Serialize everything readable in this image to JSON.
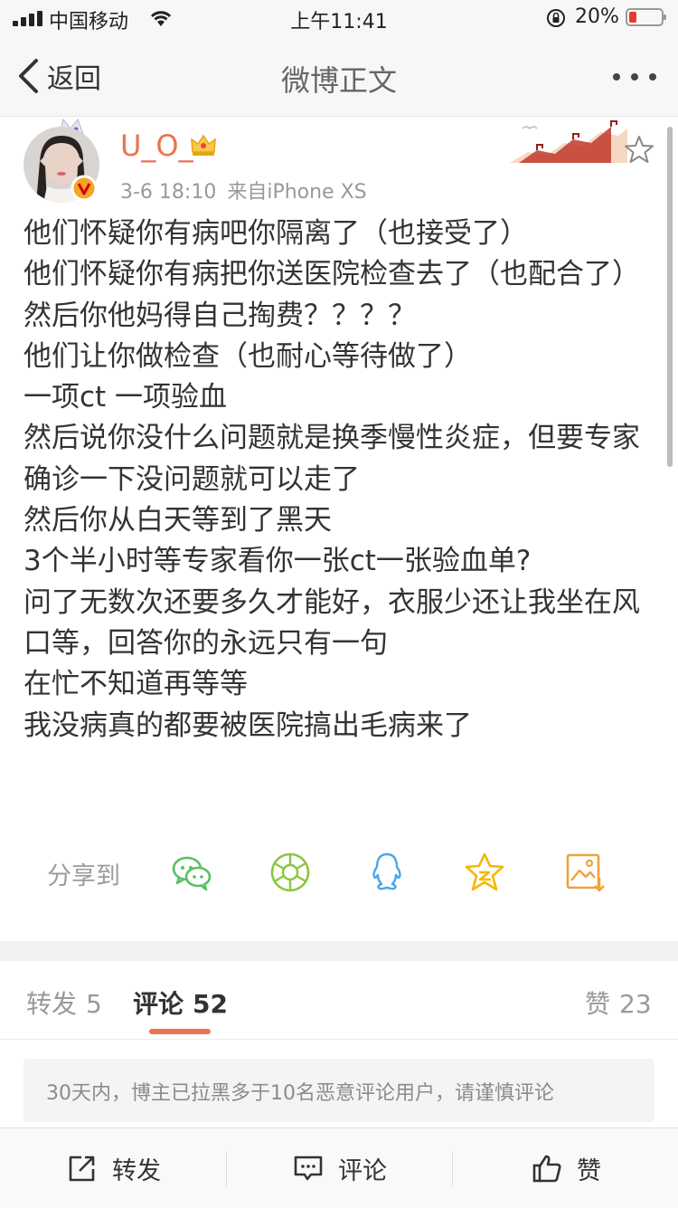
{
  "status_bar": {
    "carrier": "中国移动",
    "time": "上午11:41",
    "battery": "20%"
  },
  "nav": {
    "back_label": "返回",
    "title": "微博正文"
  },
  "post": {
    "username": "U_O_",
    "timestamp": "3-6 18:10",
    "source": "来自iPhone XS",
    "lines": [
      "他们怀疑你有病吧你隔离了（也接受了）",
      "他们怀疑你有病把你送医院检查去了（也配合了）",
      "然后你他妈得自己掏费？？？？",
      "他们让你做检查（也耐心等待做了）",
      "一项ct 一项验血",
      "然后说你没什么问题就是换季慢性炎症，但要专家确诊一下没问题就可以走了",
      "然后你从白天等到了黑天",
      "3个半小时等专家看你一张ct一张验血单?",
      "问了无数次还要多久才能好，衣服少还让我坐在风口等，回答你的永远只有一句",
      "在忙不知道再等等",
      "我没病真的都要被医院搞出毛病来了"
    ]
  },
  "share": {
    "label": "分享到",
    "targets": [
      "wechat-icon",
      "moments-icon",
      "qq-icon",
      "qzone-icon",
      "save-image-icon"
    ]
  },
  "tabs": {
    "repost": {
      "label": "转发",
      "count": "5"
    },
    "comment": {
      "label": "评论",
      "count": "52"
    },
    "like": {
      "label": "赞",
      "count": "23"
    }
  },
  "notice": "30天内，博主已拉黑多于10名恶意评论用户，请谨慎评论",
  "actions": {
    "repost": "转发",
    "comment": "评论",
    "like": "赞"
  },
  "colors": {
    "accent": "#eb7350",
    "background": "#ffffff",
    "bar": "#f7f7f7"
  }
}
